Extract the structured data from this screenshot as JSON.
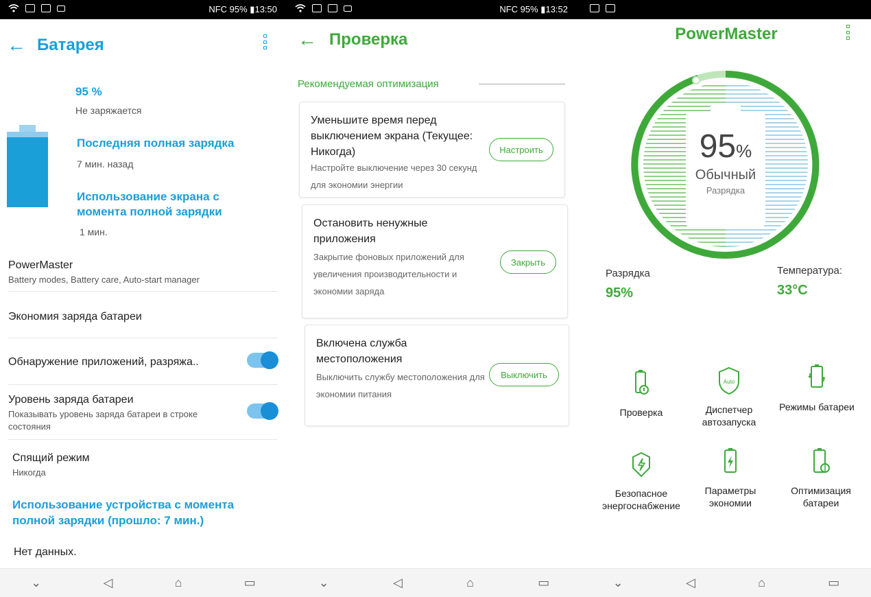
{
  "panel1": {
    "status": {
      "right": "NFC 95% ▮13:50"
    },
    "title": "Батарея",
    "percent": "95 %",
    "charging": "Не заряжается",
    "last_full_label": "Последняя полная зарядка",
    "last_full_value": "7 мин. назад",
    "screen_usage_label": "Использование экрана с момента полной зарядки",
    "screen_usage_value": "1 мин.",
    "items": [
      {
        "title": "PowerMaster",
        "subtitle": "Battery modes, Battery care, Auto-start manager"
      },
      {
        "title": "Экономия заряда батареи"
      },
      {
        "title": "Обнаружение приложений, разряжа.."
      },
      {
        "title": "Уровень заряда батареи",
        "subtitle": "Показывать уровень заряда батареи в строке состояния"
      },
      {
        "title": "Спящий режим",
        "subtitle": "Никогда"
      }
    ],
    "device_usage_label": "Использование устройства с момента полной зарядки (прошло: 7 мин.)",
    "no_data": "Нет данных."
  },
  "panel2": {
    "status": {
      "right": "NFC 95% ▮13:52"
    },
    "title": "Проверка",
    "section": "Рекомендуемая оптимизация",
    "cards": [
      {
        "title": "Уменьшите время перед выключением экрана (Текущее: Никогда)",
        "desc": "Настройте выключение через 30 секунд для экономии энергии",
        "button": "Настроить"
      },
      {
        "title": "Остановить ненужные приложения",
        "desc": "Закрытие фоновых приложений для увеличения производительности и экономии заряда",
        "button": "Закрыть"
      },
      {
        "title": "Включена служба местоположения",
        "desc": "Выключить службу местоположения для экономии питания",
        "button": "Выключить"
      }
    ]
  },
  "panel3": {
    "title": "PowerMaster",
    "gauge_percent": "95",
    "gauge_unit": "%",
    "gauge_mode": "Обычный",
    "gauge_sub": "Разрядка",
    "discharge_label": "Разрядка",
    "discharge_value": "95%",
    "temp_label": "Температура:",
    "temp_value": "33°C",
    "tiles": [
      {
        "label": "Проверка",
        "icon": "battery-check-icon"
      },
      {
        "label": "Диспетчер автозапуска",
        "icon": "auto-shield-icon"
      },
      {
        "label": "Режимы батареи",
        "icon": "battery-modes-icon"
      },
      {
        "label": "Безопасное энергоснабжение",
        "icon": "safe-power-icon"
      },
      {
        "label": "Параметры экономии",
        "icon": "battery-bolt-icon"
      },
      {
        "label": "Оптимизация батареи",
        "icon": "battery-optimize-icon"
      }
    ],
    "colors": {
      "accent": "#3ea93a",
      "blue": "#1a9fd8"
    }
  }
}
